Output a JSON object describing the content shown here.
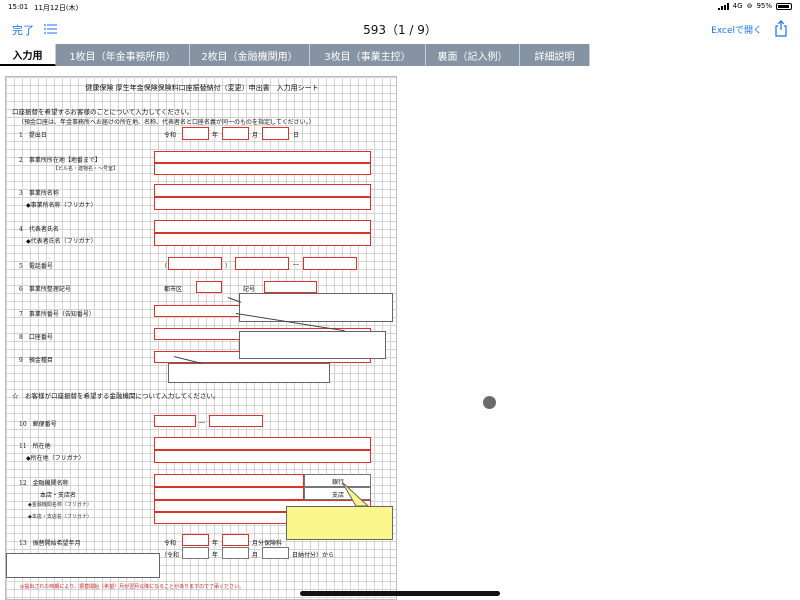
{
  "status_bar": {
    "time": "15:01",
    "date": "11月12日(木)",
    "network": "4G",
    "battery": "95%"
  },
  "nav": {
    "done": "完了",
    "title": "593（1 / 9）",
    "open_in_excel": "Excelで開く"
  },
  "tabs": [
    {
      "label": "入力用",
      "active": true
    },
    {
      "label": "1枚目（年金事務所用）",
      "active": false
    },
    {
      "label": "2枚目（金融機関用）",
      "active": false
    },
    {
      "label": "3枚目（事業主控）",
      "active": false
    },
    {
      "label": "裏面（記入例）",
      "active": false
    },
    {
      "label": "詳細説明",
      "active": false
    }
  ],
  "sheet": {
    "title": "健康保険 厚生年金保険保険料口座振替納付（変更）申出書　入力用シート",
    "section1_head": "口座振替を希望するお客様のことについて入力してください。",
    "section1_note": "（預金口座は、年金事務所へお届けの所在地、名称、代表者名と口座名義が同一のものを指定してください。）",
    "fields": {
      "f1": "1　提出日",
      "f1_era": "令和",
      "f1_year": "年",
      "f1_month": "月",
      "f1_day": "日",
      "f2": "2　事業所所在地【地番まで】",
      "f2_sub": "【ビル名・建物名・〜号室】",
      "f3": "3　事業所名称",
      "f3_sub": "◆事業所名称（フリガナ）",
      "f4": "4　代表者氏名",
      "f4_sub": "◆代表者氏名（フリガナ）",
      "f5": "5　電話番号",
      "f5_open": "（",
      "f5_close": "）",
      "f5_dash": "―",
      "f6": "6　事業所整理記号",
      "f6_city": "都市区",
      "f6_code": "記号",
      "f7": "7　事業所番号（告知番号）",
      "f8": "8　口座番号",
      "f9": "9　預金種目"
    },
    "section2_head": "☆　お客様が口座振替を希望する金融機関について入力してください。",
    "fields2": {
      "f10": "10　郵便番号",
      "f10_dash": "―",
      "f11": "11　所在地",
      "f11_sub": "◆所在地（フリガナ）",
      "f12": "12　金融機関名称",
      "f12_sub": "本店・支店名",
      "f12_sub2": "◆金融機関名称（フリガナ）",
      "f12_sub3": "◆本店・支店名（フリガナ）",
      "f12_bank": "銀行",
      "f12_branch": "支店",
      "f13": "13　振替開始希望年月",
      "f13_era1": "令和",
      "f13_era2": "（令和",
      "f13_year": "年",
      "f13_month_premium": "月分保険料",
      "f13_year2": "年",
      "f13_month2": "月",
      "f13_from": "日納付分）から"
    },
    "footer": "◎提出された時期により、振替開始（希望）月が翌月以降になることがありますので了承ください。"
  },
  "colors": {
    "tab_bg": "#8593a3",
    "input_border": "#d9342b",
    "link_blue": "#1a73e8",
    "callout_yellow": "#fbf78a"
  },
  "icons": [
    "list-icon",
    "share-icon",
    "battery-icon",
    "signal-icon",
    "wifi-icon"
  ]
}
